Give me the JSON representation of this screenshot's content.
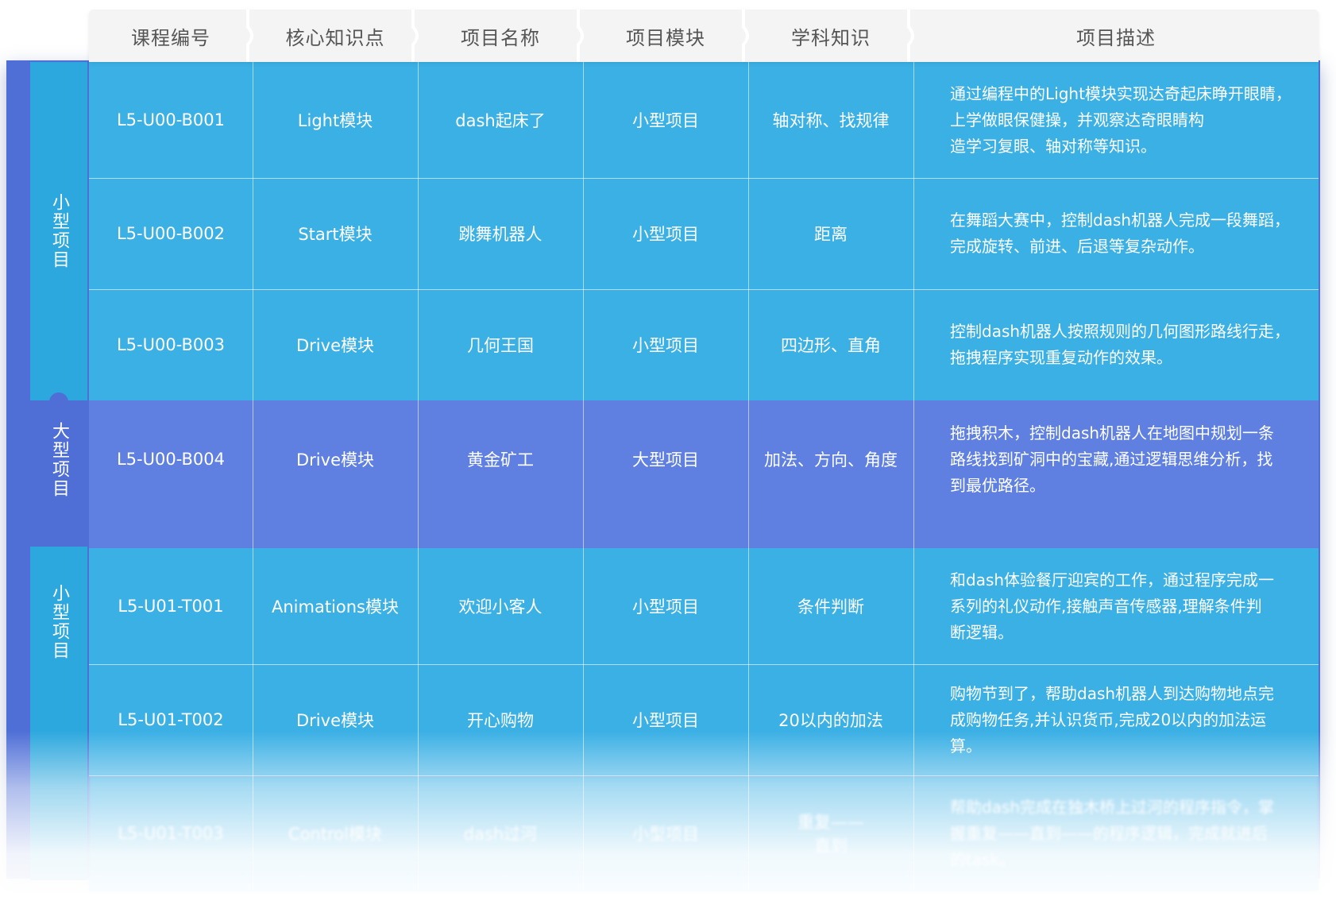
{
  "header": {
    "columns": [
      "课程编号",
      "核心知识点",
      "项目名称",
      "项目模块",
      "学科知识",
      "项目描述"
    ]
  },
  "groups": {
    "g1": "小型项目",
    "g2": "大型项目",
    "g3": "小型项目"
  },
  "rows": [
    {
      "code": "L5-U00-B001",
      "knowledge": "Light模块",
      "name": "dash起床了",
      "module": "小型项目",
      "subject": "轴对称、找规律",
      "desc": [
        "通过编程中的Light模块实现达奇起床睁开眼睛，",
        "上学做眼保健操，并观察达奇眼睛构",
        "造学习复眼、轴对称等知识。"
      ]
    },
    {
      "code": "L5-U00-B002",
      "knowledge": "Start模块",
      "name": "跳舞机器人",
      "module": "小型项目",
      "subject": "距离",
      "desc": [
        "在舞蹈大赛中，控制dash机器人完成一段舞蹈，",
        "完成旋转、前进、后退等复杂动作。"
      ]
    },
    {
      "code": "L5-U00-B003",
      "knowledge": "Drive模块",
      "name": "几何王国",
      "module": "小型项目",
      "subject": "四边形、直角",
      "desc": [
        "控制dash机器人按照规则的几何图形路线行走，",
        "拖拽程序实现重复动作的效果。"
      ]
    },
    {
      "code": "L5-U00-B004",
      "knowledge": "Drive模块",
      "name": "黄金矿工",
      "module": "大型项目",
      "subject": "加法、方向、角度",
      "desc": [
        "拖拽积木，控制dash机器人在地图中规划一条",
        "路线找到矿洞中的宝藏,通过逻辑思维分析，找",
        "到最优路径。"
      ]
    },
    {
      "code": "L5-U01-T001",
      "knowledge": "Animations模块",
      "name": "欢迎小客人",
      "module": "小型项目",
      "subject": "条件判断",
      "desc": [
        "和dash体验餐厅迎宾的工作，通过程序完成一",
        "系列的礼仪动作,接触声音传感器,理解条件判",
        "断逻辑。"
      ]
    },
    {
      "code": "L5-U01-T002",
      "knowledge": "Drive模块",
      "name": "开心购物",
      "module": "小型项目",
      "subject": "20以内的加法",
      "desc": [
        "购物节到了，帮助dash机器人到达购物地点完",
        "成购物任务,并认识货币,完成20以内的加法运",
        "算。"
      ]
    },
    {
      "code": "L5-U01-T003",
      "knowledge": "Control模块",
      "name": "dash过河",
      "module": "小型项目",
      "subject": "重复——\n直到",
      "desc": [
        "帮助dash完成在独木桥上过河的程序指令，掌",
        "握重复——直到——的程序逻辑，完成就进后",
        "的task。"
      ]
    }
  ],
  "colors": {
    "row_blue": "#3bb0e5",
    "row_purple": "#5f80e1",
    "frame": "#4f6fd6",
    "header_bg": "#f4f4f5",
    "header_text": "#555555"
  }
}
